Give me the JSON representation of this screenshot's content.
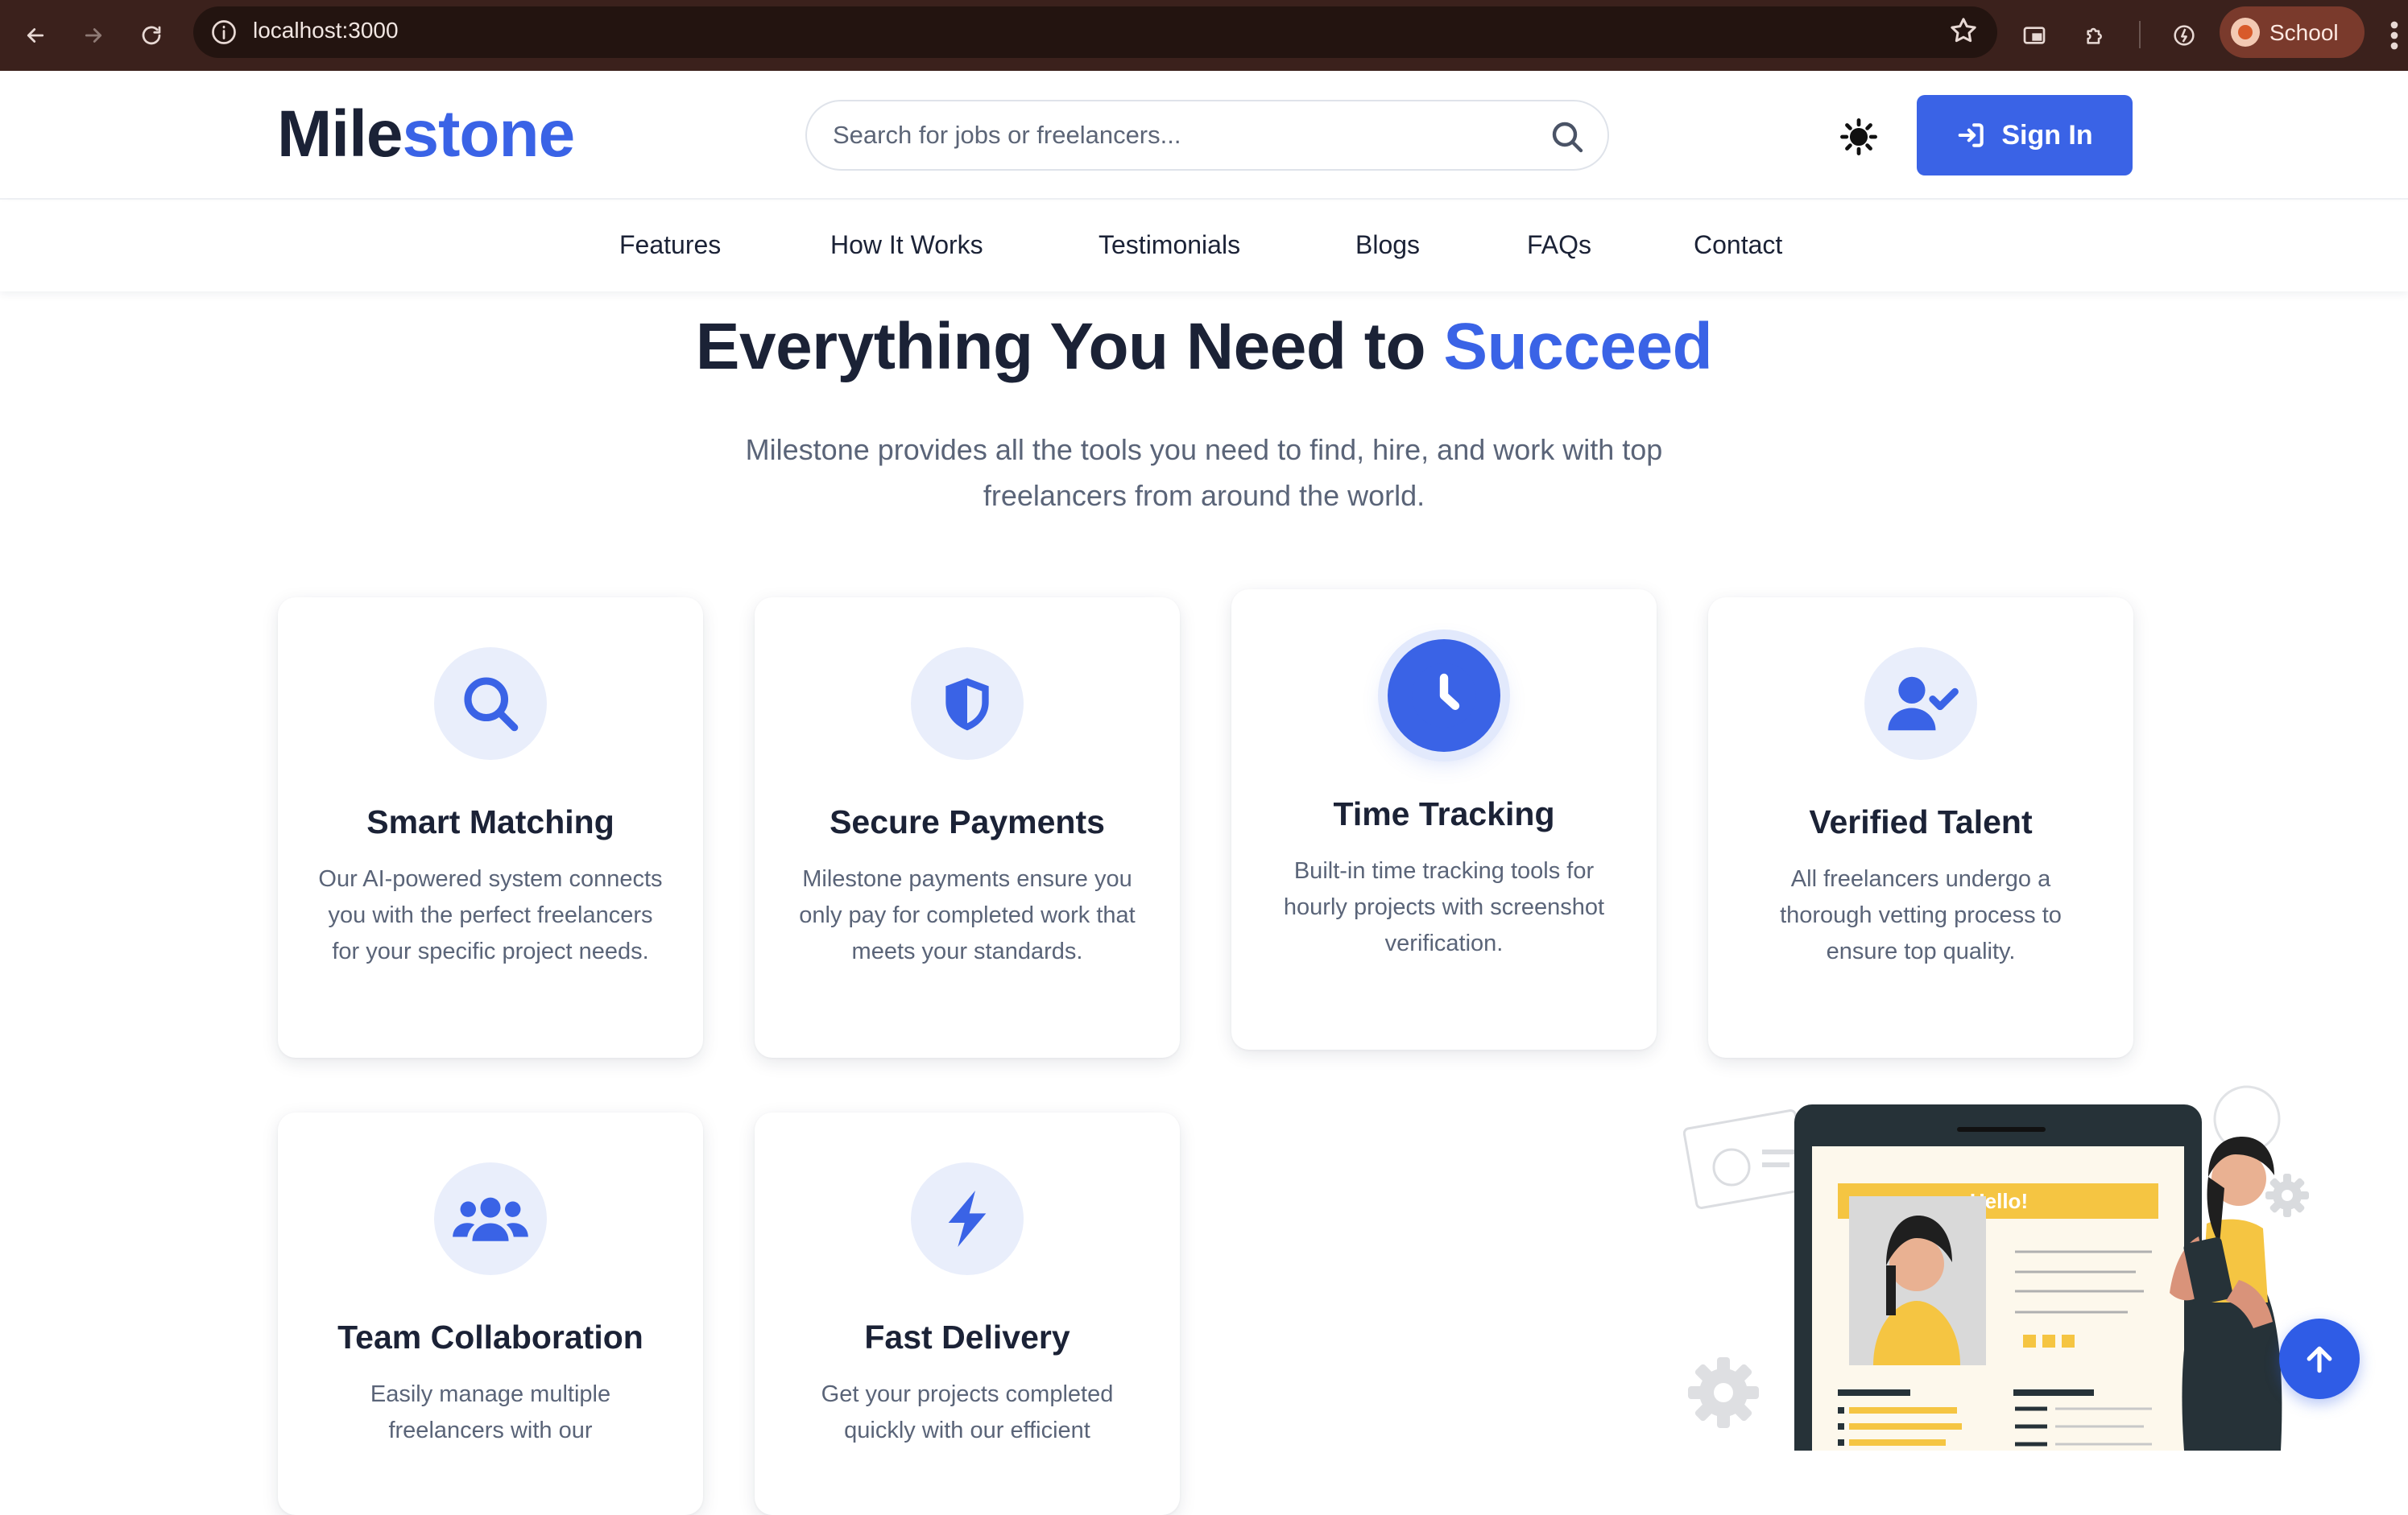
{
  "browser": {
    "url": "localhost:3000",
    "profile_name": "School"
  },
  "header": {
    "logo_part1": "Mile",
    "logo_part2": "stone",
    "search_placeholder": "Search for jobs or freelancers...",
    "signin_label": "Sign In"
  },
  "subnav": {
    "items": [
      "Features",
      "How It Works",
      "Testimonials",
      "Blogs",
      "FAQs",
      "Contact"
    ]
  },
  "hero": {
    "title_main": "Everything You Need to ",
    "title_accent": "Succeed",
    "subtitle": "Milestone provides all the tools you need to find, hire, and work with top freelancers from around the world."
  },
  "features": [
    {
      "title": "Smart Matching",
      "icon": "search-icon",
      "text": "Our AI-powered system connects you with the perfect freelancers for your specific project needs."
    },
    {
      "title": "Secure Payments",
      "icon": "shield-icon",
      "text": "Milestone payments ensure you only pay for completed work that meets your standards."
    },
    {
      "title": "Time Tracking",
      "icon": "clock-icon",
      "text": "Built-in time tracking tools for hourly projects with screenshot verification."
    },
    {
      "title": "Verified Talent",
      "icon": "user-check-icon",
      "text": "All freelancers undergo a thorough vetting process to ensure top quality."
    },
    {
      "title": "Team Collaboration",
      "icon": "users-icon",
      "text": "Easily manage multiple freelancers with our"
    },
    {
      "title": "Fast Delivery",
      "icon": "bolt-icon",
      "text": "Get your projects completed quickly with our efficient"
    }
  ],
  "illustration": {
    "greeting": "Hello!"
  },
  "colors": {
    "brand": "#3a63e6",
    "dark": "#1b2236",
    "muted": "#5a6478",
    "chrome": "#3b211c",
    "accent_yellow": "#f5c542"
  }
}
